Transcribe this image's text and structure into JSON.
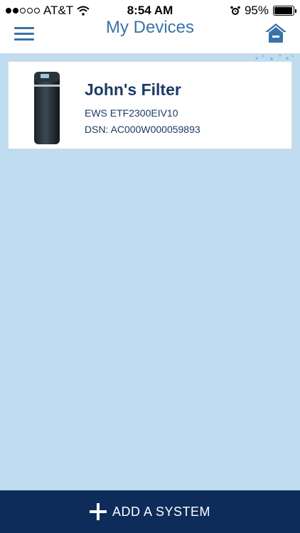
{
  "status_bar": {
    "carrier": "AT&T",
    "time": "8:54 AM",
    "battery": "95%",
    "battery_level": 0.95,
    "signal_full_dots": 2,
    "signal_total_dots": 5
  },
  "nav": {
    "title": "My Devices",
    "menu_icon": "menu-icon",
    "home_icon": "home-icon"
  },
  "device": {
    "name": "John's Filter",
    "model": "EWS ETF2300EIV10",
    "dsn": "DSN: AC000W000059893"
  },
  "bottom": {
    "add_label": "ADD A SYSTEM",
    "add_icon": "plus-icon"
  },
  "colors": {
    "brand_blue": "#3a73a8",
    "navy": "#0e2c5a",
    "background": "#bfdcf0",
    "text_dark": "#1b3a66"
  }
}
